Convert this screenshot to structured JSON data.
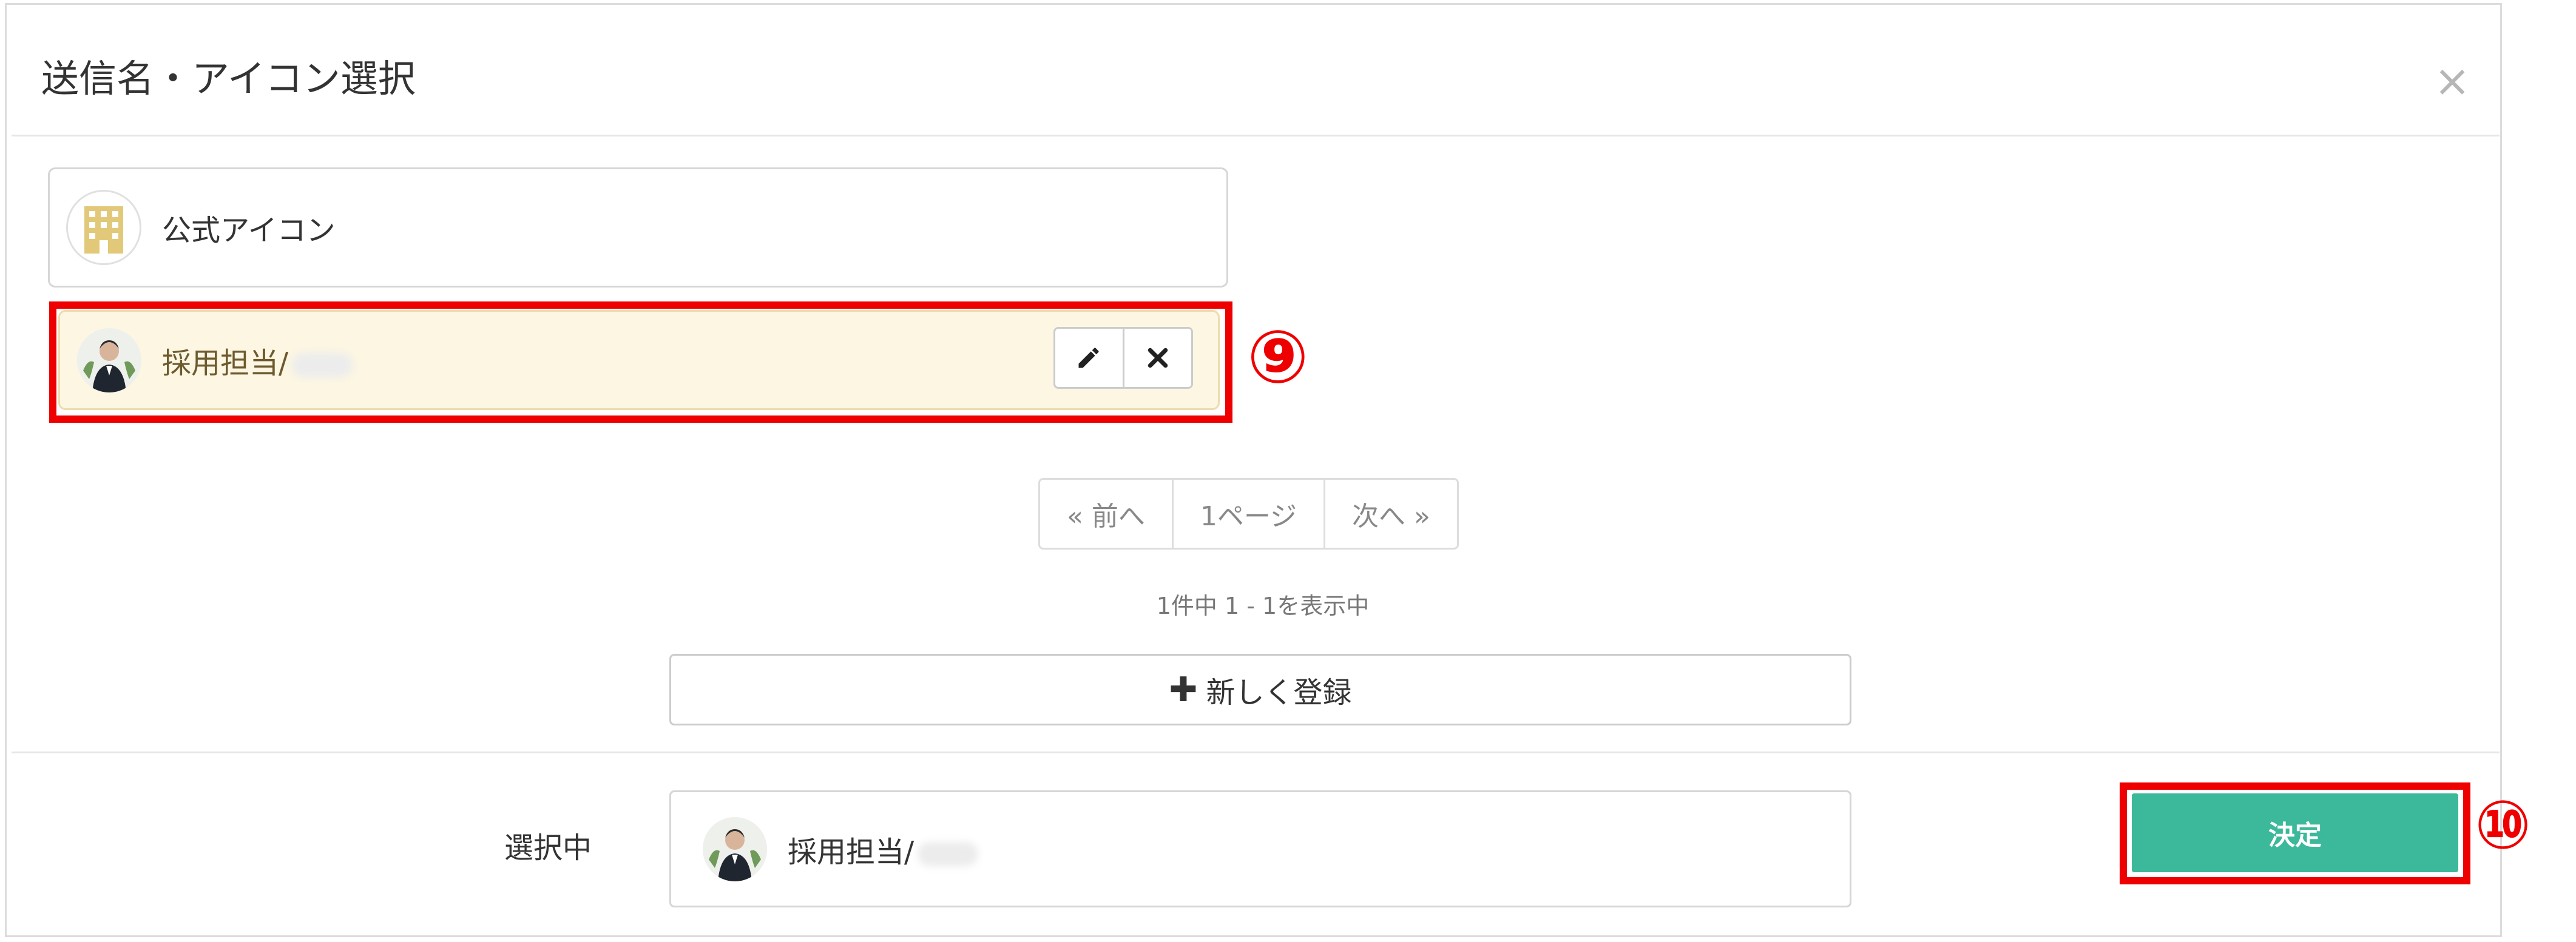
{
  "modal": {
    "title": "送信名・アイコン選択",
    "close_label": "×"
  },
  "items": [
    {
      "label": "公式アイコン",
      "icon": "building-icon"
    },
    {
      "label": "採用担当/",
      "icon": "person-avatar",
      "selected": true
    }
  ],
  "item_actions": {
    "edit_icon": "pencil-icon",
    "delete_icon": "close-icon"
  },
  "callouts": {
    "nine": "⑨",
    "ten": "⑩"
  },
  "pagination": {
    "prev": "« 前へ",
    "page": "1ページ",
    "next": "次へ »"
  },
  "result_count": "1件中 1 - 1を表示中",
  "new_register": {
    "label": "新しく登録",
    "icon": "plus-icon"
  },
  "selected": {
    "label": "選択中",
    "value": "採用担当/"
  },
  "confirm_label": "決定",
  "colors": {
    "highlight": "#ee0000",
    "confirm": "#3cb89a",
    "selected_item_bg": "#fcf6e3"
  }
}
